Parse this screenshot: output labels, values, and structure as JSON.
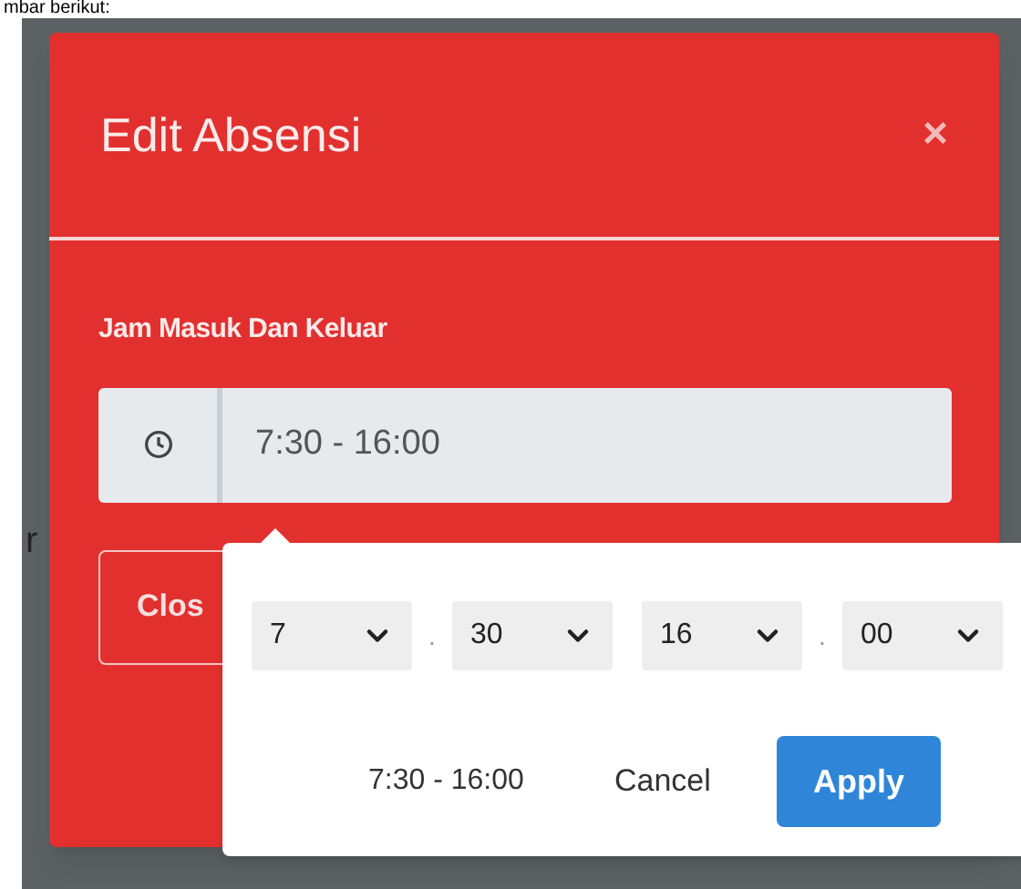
{
  "page_text": "mbar berikut:",
  "background_text": "r",
  "modal": {
    "title": "Edit Absensi",
    "close_icon": "×",
    "field_label": "Jam Masuk Dan Keluar",
    "time_range_value": "7:30 - 16:00",
    "close_button": "Clos"
  },
  "time_picker": {
    "selects": [
      {
        "value": "7",
        "separator": "."
      },
      {
        "value": "30"
      },
      {
        "value": "16",
        "separator": "."
      },
      {
        "value": "00"
      }
    ],
    "summary": "7:30 - 16:00",
    "cancel": "Cancel",
    "apply": "Apply"
  }
}
